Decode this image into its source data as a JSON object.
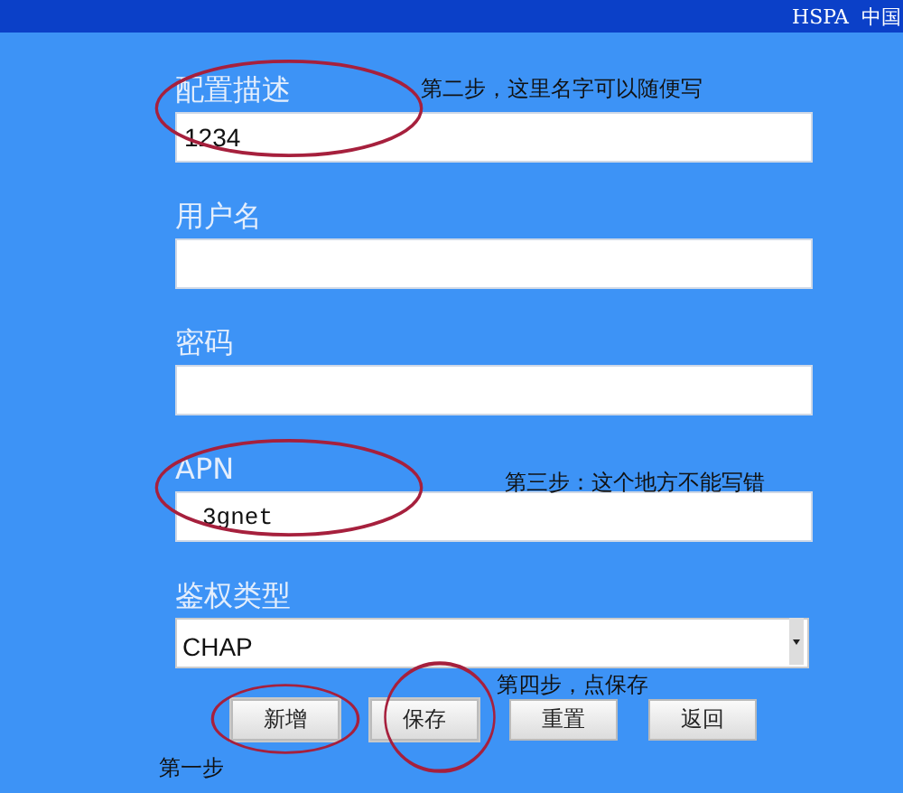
{
  "header": {
    "text": "HSPA  中国"
  },
  "fields": [
    {
      "label": "配置描述",
      "kind": "text",
      "value": "1234",
      "circled": true,
      "note": "第二步，这里名字可以随便写"
    },
    {
      "label": "用户名",
      "kind": "text",
      "circled": false
    },
    {
      "label": "密码",
      "kind": "text",
      "circled": false
    },
    {
      "label": "APN",
      "kind": "text",
      "value": "3gnet",
      "circled": true,
      "note": "第三步：这个地方不能写错"
    },
    {
      "label": "鉴权类型",
      "kind": "select",
      "value": "CHAP",
      "circled": false
    }
  ],
  "buttons_note": "第四步，点保存",
  "buttons": [
    {
      "label": "新增",
      "circled": true
    },
    {
      "label": "保存",
      "circled": true
    },
    {
      "label": "重置",
      "circled": false
    },
    {
      "label": "返回",
      "circled": false
    }
  ],
  "footer_note": "第一步"
}
